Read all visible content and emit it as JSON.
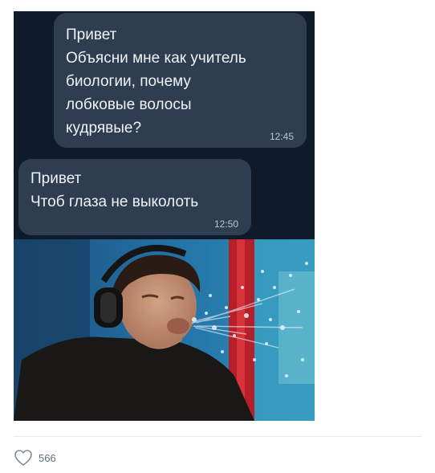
{
  "messages": [
    {
      "lines": [
        "Привет",
        "Объясни мне как учитель",
        "биологии, почему",
        "лобковые волосы",
        "кудрявые?"
      ],
      "time": "12:45"
    },
    {
      "lines": [
        "Привет",
        "Чтоб глаза не выколоть"
      ],
      "time": "12:50"
    }
  ],
  "likes": {
    "icon": "heart-icon",
    "count": "566"
  },
  "colors": {
    "chat_background": "#0f1b2b",
    "bubble": "#2e3d4f",
    "bubble_text": "#eef3f8",
    "divider": "#e7e8ec",
    "like_text": "#5f6d7d"
  }
}
